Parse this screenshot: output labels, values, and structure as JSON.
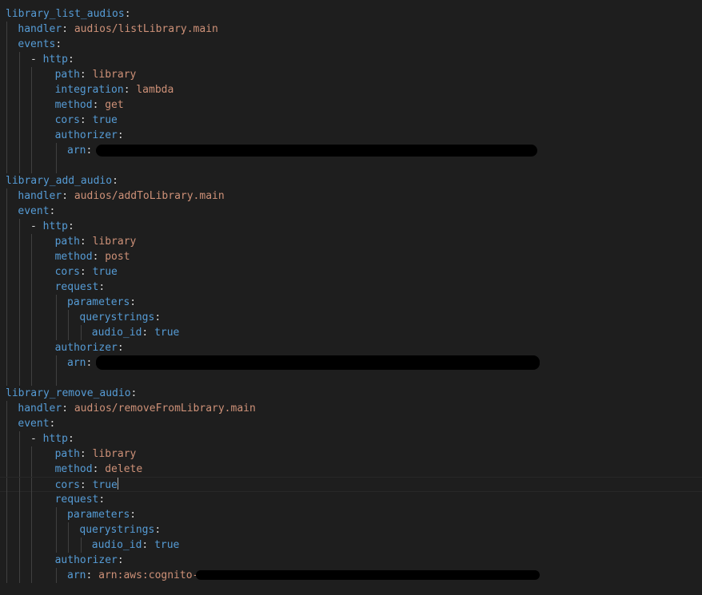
{
  "editor": {
    "lines": [
      {
        "indent": 0,
        "key": "library_list_audios"
      },
      {
        "indent": 1,
        "key": "handler",
        "value": "audios/listLibrary.main",
        "vtype": "str"
      },
      {
        "indent": 1,
        "key": "events"
      },
      {
        "indent": 2,
        "dash": "- ",
        "key": "http"
      },
      {
        "indent": 4,
        "key": "path",
        "value": "library",
        "vtype": "str"
      },
      {
        "indent": 4,
        "key": "integration",
        "value": "lambda",
        "vtype": "str"
      },
      {
        "indent": 4,
        "key": "method",
        "value": "get",
        "vtype": "str"
      },
      {
        "indent": 4,
        "key": "cors",
        "value": "true",
        "vtype": "bool"
      },
      {
        "indent": 4,
        "key": "authorizer"
      },
      {
        "indent": 5,
        "key": "arn",
        "redacted": true
      },
      {
        "indent": 0,
        "blank": true
      },
      {
        "indent": 0,
        "key": "library_add_audio"
      },
      {
        "indent": 1,
        "key": "handler",
        "value": "audios/addToLibrary.main",
        "vtype": "str"
      },
      {
        "indent": 1,
        "key": "event"
      },
      {
        "indent": 2,
        "dash": "- ",
        "key": "http"
      },
      {
        "indent": 4,
        "key": "path",
        "value": "library",
        "vtype": "str"
      },
      {
        "indent": 4,
        "key": "method",
        "value": "post",
        "vtype": "str"
      },
      {
        "indent": 4,
        "key": "cors",
        "value": "true",
        "vtype": "bool"
      },
      {
        "indent": 4,
        "key": "request"
      },
      {
        "indent": 5,
        "key": "parameters"
      },
      {
        "indent": 6,
        "key": "querystrings"
      },
      {
        "indent": 7,
        "key": "audio_id",
        "value": "true",
        "vtype": "bool"
      },
      {
        "indent": 4,
        "key": "authorizer"
      },
      {
        "indent": 5,
        "key": "arn",
        "redacted": true
      },
      {
        "indent": 0,
        "blank": true
      },
      {
        "indent": 0,
        "key": "library_remove_audio"
      },
      {
        "indent": 1,
        "key": "handler",
        "value": "audios/removeFromLibrary.main",
        "vtype": "str"
      },
      {
        "indent": 1,
        "key": "event"
      },
      {
        "indent": 2,
        "dash": "- ",
        "key": "http"
      },
      {
        "indent": 4,
        "key": "path",
        "value": "library",
        "vtype": "str"
      },
      {
        "indent": 4,
        "key": "method",
        "value": "delete",
        "vtype": "str"
      },
      {
        "indent": 4,
        "key": "cors",
        "value": "true",
        "vtype": "bool",
        "cursor": true
      },
      {
        "indent": 4,
        "key": "request"
      },
      {
        "indent": 5,
        "key": "parameters"
      },
      {
        "indent": 6,
        "key": "querystrings"
      },
      {
        "indent": 7,
        "key": "audio_id",
        "value": "true",
        "vtype": "bool"
      },
      {
        "indent": 4,
        "key": "authorizer"
      },
      {
        "indent": 5,
        "key": "arn",
        "value": "arn:aws:cognito-",
        "vtype": "str",
        "redacted": true
      }
    ]
  },
  "colors": {
    "background": "#1e1e1e",
    "key": "#569cd6",
    "string": "#ce9178",
    "punctuation": "#d4d4d4",
    "guide": "#404040",
    "redaction": "#000000"
  }
}
